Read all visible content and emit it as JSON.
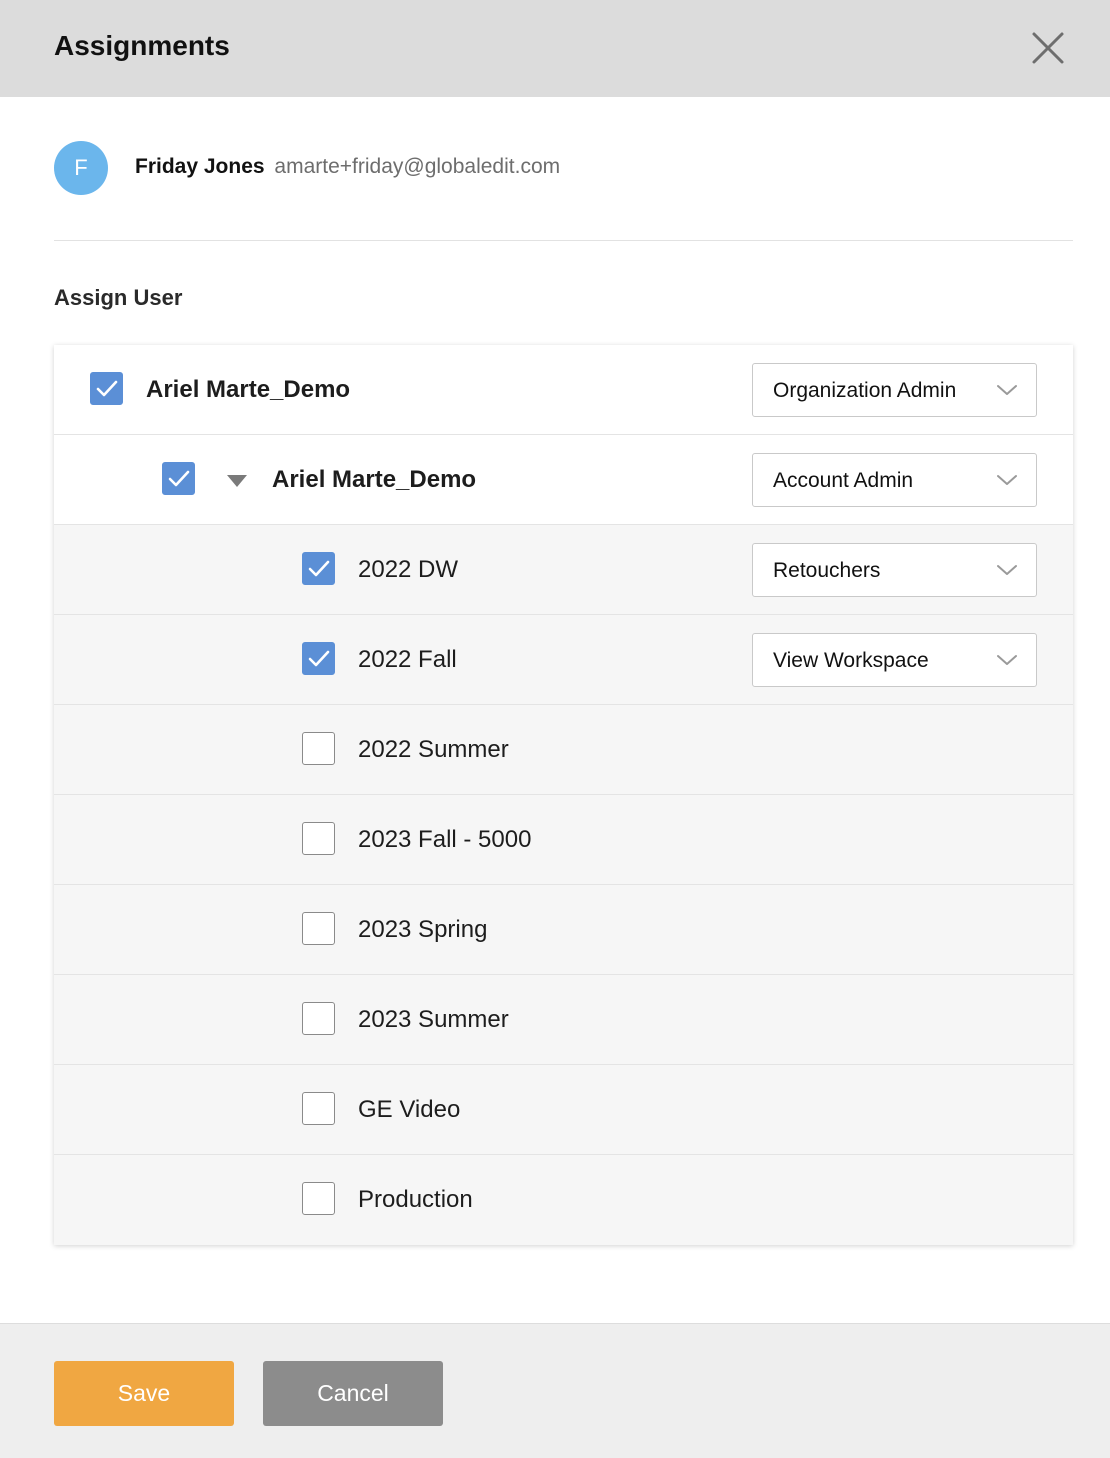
{
  "header": {
    "title": "Assignments",
    "close_icon": "close-icon"
  },
  "user": {
    "avatar_letter": "F",
    "avatar_color": "#6bb6ec",
    "name": "Friday Jones",
    "email": "amarte+friday@globaledit.com"
  },
  "section": {
    "title": "Assign User"
  },
  "tree": {
    "organization": {
      "label": "Ariel Marte_Demo",
      "checked": true,
      "role": "Organization Admin"
    },
    "account": {
      "label": "Ariel Marte_Demo",
      "checked": true,
      "expanded": true,
      "role": "Account Admin"
    },
    "workspaces": [
      {
        "label": "2022 DW",
        "checked": true,
        "role": "Retouchers"
      },
      {
        "label": "2022 Fall",
        "checked": true,
        "role": "View Workspace"
      },
      {
        "label": "2022 Summer",
        "checked": false,
        "role": ""
      },
      {
        "label": "2023 Fall - 5000",
        "checked": false,
        "role": ""
      },
      {
        "label": "2023 Spring",
        "checked": false,
        "role": ""
      },
      {
        "label": "2023 Summer",
        "checked": false,
        "role": ""
      },
      {
        "label": "GE Video",
        "checked": false,
        "role": ""
      },
      {
        "label": "Production",
        "checked": false,
        "role": ""
      }
    ]
  },
  "footer": {
    "save_label": "Save",
    "cancel_label": "Cancel"
  },
  "colors": {
    "header_bg": "#dcdcdc",
    "checkbox_checked": "#5b8fd6",
    "save_button": "#f0a742",
    "cancel_button": "#8c8c8c"
  }
}
